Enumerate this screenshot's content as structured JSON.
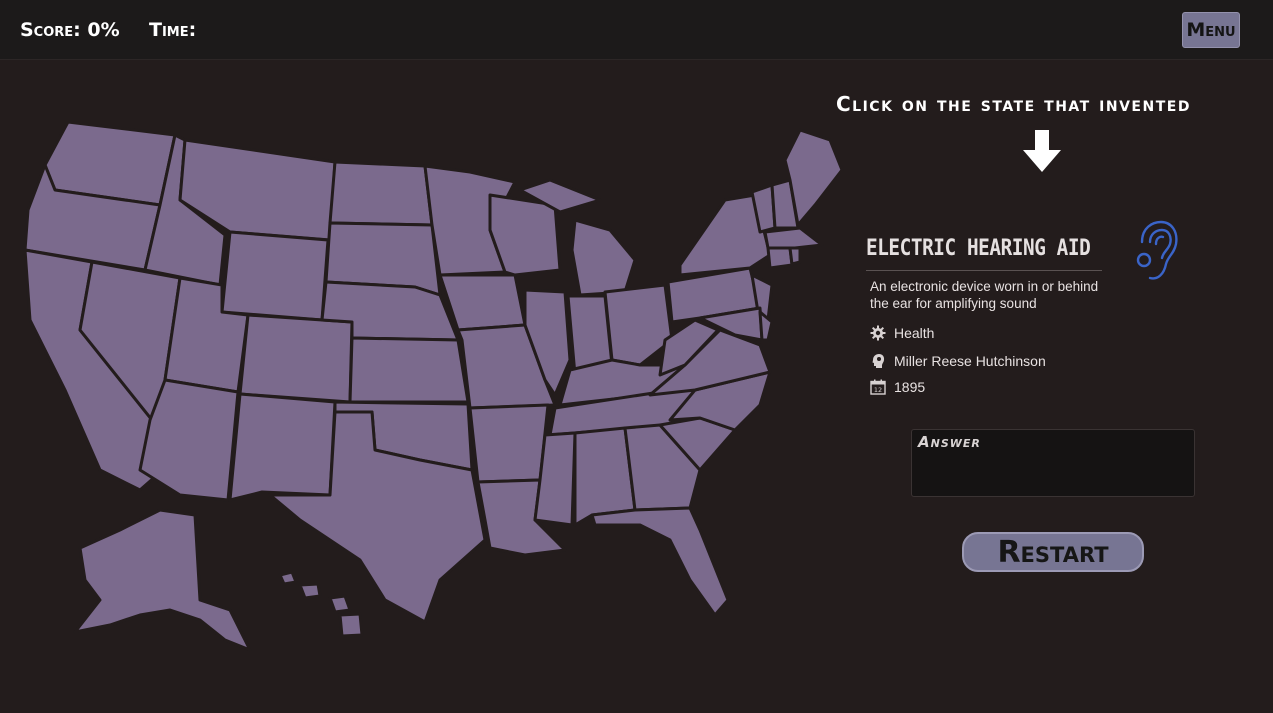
{
  "topbar": {
    "score_label": "Score: 0%",
    "time_label": "Time:",
    "menu_label": "Menu"
  },
  "game": {
    "prompt": "Click on the state that invented",
    "invention": {
      "title": "ELECTRIC HEARING AID",
      "description": "An electronic device worn in or behind the ear for amplifying sound",
      "category": "Health",
      "inventor": "Miller Reese Hutchinson",
      "year": "1895"
    },
    "answer_label": "Answer",
    "restart_label": "Restart"
  },
  "icons": {
    "arrow": "down-arrow-icon",
    "invention": "ear-icon",
    "category": "gear-icon",
    "inventor": "head-icon",
    "year": "calendar-icon"
  },
  "colors": {
    "background": "#231c1c",
    "state_fill": "#7b6a8d",
    "button": "#777593",
    "icon_blue": "#3a64c8"
  }
}
